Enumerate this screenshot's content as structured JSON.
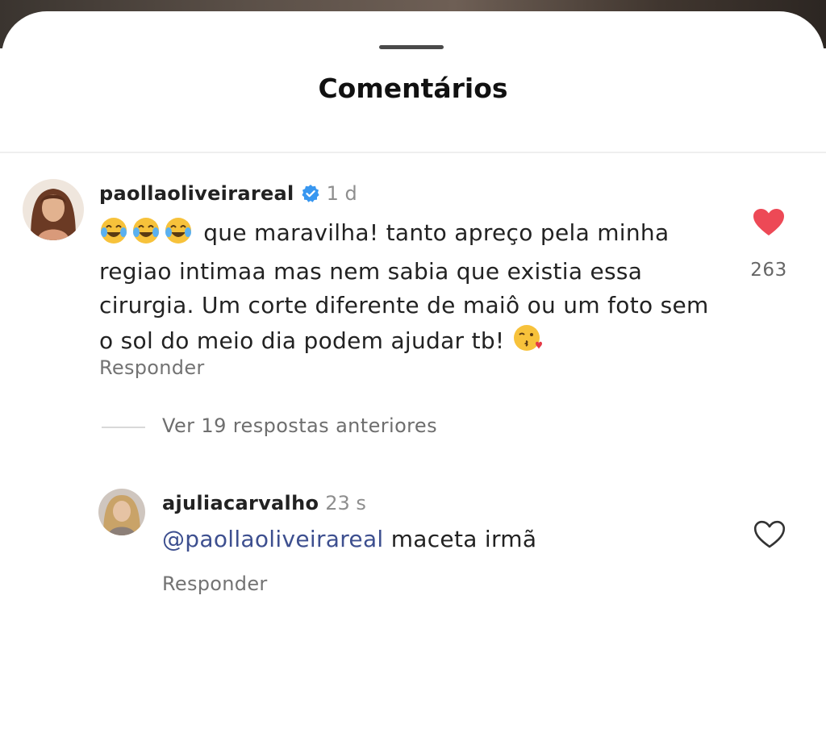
{
  "sheet": {
    "title": "Comentários"
  },
  "comment": {
    "username": "paollaoliveirareal",
    "verified": true,
    "time": "1 d",
    "emojis": [
      "laughing-tears",
      "laughing-tears",
      "laughing-tears"
    ],
    "text": "que maravilha! tanto apreço pela minha regiao intimaa mas nem sabia que existia essa cirurgia. Um corte diferente de maiô ou um foto sem o sol do meio dia podem ajudar tb!",
    "end_emoji": "kissing-heart",
    "likes": "263",
    "liked": true,
    "reply_label": "Responder"
  },
  "thread": {
    "view_replies": "Ver 19 respostas anteriores"
  },
  "reply": {
    "username": "ajuliacarvalho",
    "time": "23 s",
    "mention": "@paollaoliveirareal",
    "text": "maceta irmã",
    "liked": false,
    "reply_label": "Responder"
  },
  "colors": {
    "like_red": "#ed4956",
    "verified_blue": "#3897f0",
    "mention_blue": "#3d4f8f",
    "secondary_text": "#8e8e8e"
  }
}
